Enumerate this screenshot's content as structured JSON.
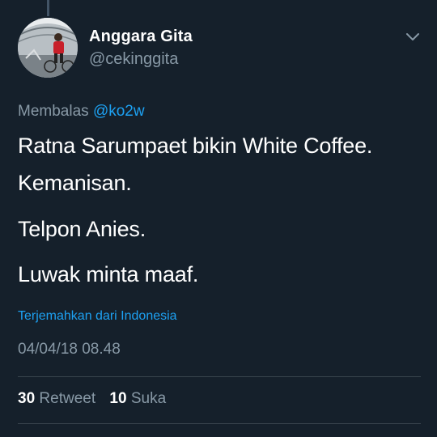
{
  "user": {
    "name": "Anggara Gita",
    "handle": "@cekinggita"
  },
  "reply": {
    "prefix": "Membalas",
    "mention": "@ko2w"
  },
  "tweet": {
    "lines": [
      "Ratna Sarumpaet bikin White Coffee.",
      "Kemanisan.",
      "Telpon Anies.",
      "Luwak minta maaf."
    ],
    "translate_link": "Terjemahkan dari Indonesia",
    "timestamp": "04/04/18 08.48"
  },
  "stats": {
    "retweets_count": "30",
    "retweets_label": "Retweet",
    "likes_count": "10",
    "likes_label": "Suka"
  },
  "icons": {
    "menu": "chevron-down-icon"
  },
  "colors": {
    "background": "#15202b",
    "link": "#1da1f2",
    "muted": "#8899a6",
    "text": "#ffffff"
  }
}
